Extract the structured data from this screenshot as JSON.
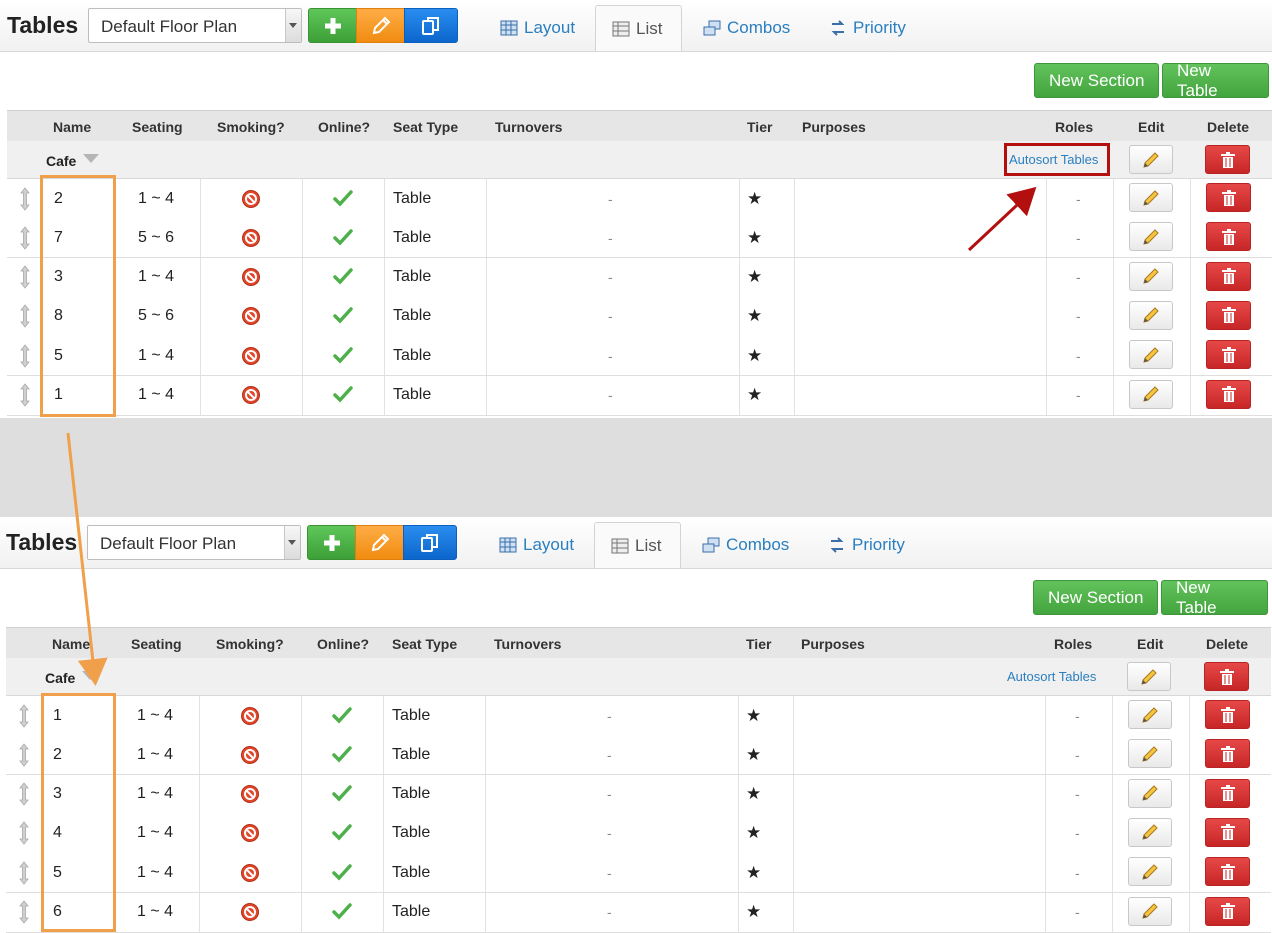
{
  "app": {
    "title": "Tables",
    "floor_plan_select": "Default Floor Plan"
  },
  "tabs": [
    {
      "label": "Layout",
      "icon": "grid-icon",
      "active": false
    },
    {
      "label": "List",
      "icon": "list-icon",
      "active": true
    },
    {
      "label": "Combos",
      "icon": "combo-icon",
      "active": false
    },
    {
      "label": "Priority",
      "icon": "priority-icon",
      "active": false
    }
  ],
  "actions": {
    "new_section": "New Section",
    "new_table": "New Table"
  },
  "columns": {
    "name": "Name",
    "seating": "Seating",
    "smoking": "Smoking?",
    "online": "Online?",
    "seat_type": "Seat Type",
    "turnovers": "Turnovers",
    "tier": "Tier",
    "purposes": "Purposes",
    "roles": "Roles",
    "edit": "Edit",
    "delete": "Delete"
  },
  "section": {
    "name": "Cafe",
    "autosort": "Autosort Tables"
  },
  "before": {
    "rows": [
      {
        "name": "2",
        "seating": "1 ~ 4",
        "seat_type": "Table",
        "turnovers": "-",
        "tier": "★",
        "roles": "-"
      },
      {
        "name": "7",
        "seating": "5 ~ 6",
        "seat_type": "Table",
        "turnovers": "-",
        "tier": "★",
        "roles": "-"
      },
      {
        "name": "3",
        "seating": "1 ~ 4",
        "seat_type": "Table",
        "turnovers": "-",
        "tier": "★",
        "roles": "-"
      },
      {
        "name": "8",
        "seating": "5 ~ 6",
        "seat_type": "Table",
        "turnovers": "-",
        "tier": "★",
        "roles": "-"
      },
      {
        "name": "5",
        "seating": "1 ~ 4",
        "seat_type": "Table",
        "turnovers": "-",
        "tier": "★",
        "roles": "-"
      },
      {
        "name": "1",
        "seating": "1 ~ 4",
        "seat_type": "Table",
        "turnovers": "-",
        "tier": "★",
        "roles": "-"
      }
    ]
  },
  "after": {
    "rows": [
      {
        "name": "1",
        "seating": "1 ~ 4",
        "seat_type": "Table",
        "turnovers": "-",
        "tier": "★",
        "roles": "-"
      },
      {
        "name": "2",
        "seating": "1 ~ 4",
        "seat_type": "Table",
        "turnovers": "-",
        "tier": "★",
        "roles": "-"
      },
      {
        "name": "3",
        "seating": "1 ~ 4",
        "seat_type": "Table",
        "turnovers": "-",
        "tier": "★",
        "roles": "-"
      },
      {
        "name": "4",
        "seating": "1 ~ 4",
        "seat_type": "Table",
        "turnovers": "-",
        "tier": "★",
        "roles": "-"
      },
      {
        "name": "5",
        "seating": "1 ~ 4",
        "seat_type": "Table",
        "turnovers": "-",
        "tier": "★",
        "roles": "-"
      },
      {
        "name": "6",
        "seating": "1 ~ 4",
        "seat_type": "Table",
        "turnovers": "-",
        "tier": "★",
        "roles": "-"
      }
    ]
  },
  "colors": {
    "annotation_orange": "#f0a04b",
    "annotation_red": "#b40f0f",
    "link_blue": "#2a7fc0",
    "button_green": "#4cb046",
    "delete_red": "#d13232"
  }
}
